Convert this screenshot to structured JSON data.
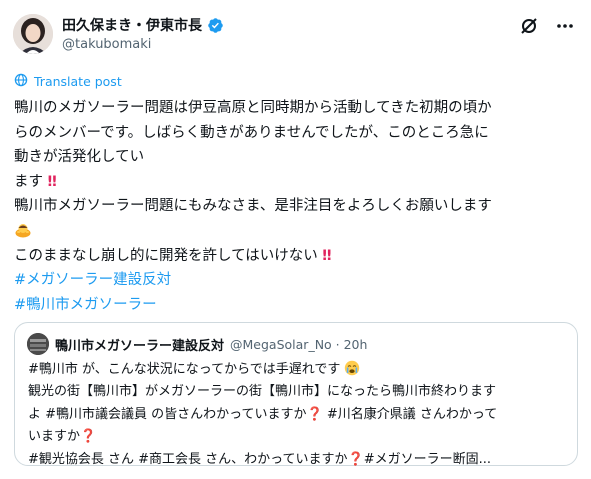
{
  "author": {
    "name": "田久保まき・伊東市長",
    "handle": "@takubomaki"
  },
  "translate": {
    "label": "Translate post"
  },
  "post": {
    "l1": "鴨川のメガソーラー問題は伊豆高原と同時期から活動してきた初期の頃か",
    "l2": "らのメンバーです。しばらく動きがありませんでしたが、このところ急に",
    "l3": "動きが活発化してい",
    "l4": "ます",
    "l5": "鴨川市メガソーラー問題にもみなさま、是非注目をよろしくお願いします",
    "l7": "このままなし崩し的に開発を許してはいけない",
    "tag1": "#メガソーラー建設反対",
    "tag2": "#鴨川市メガソーラー",
    "bang": "‼"
  },
  "quote": {
    "name": "鴨川市メガソーラー建設反対",
    "meta": "@MegaSolar_No · 20h",
    "l1": "#鴨川市 が、こんな状況になってからでは手遅れです",
    "l2": "観光の街【鴨川市】がメガソーラーの街【鴨川市】になったら鴨川市終わります",
    "l3a": "よ #鴨川市議会議員 の皆さんわかっていますか",
    "l3b": " #川名康介県議 さんわかって",
    "l4": "いますか",
    "l5a": " #観光協会長 さん #商工会長 さん、わかっていますか",
    "l5b": "#メガソーラー断固...",
    "qmark": "❓"
  },
  "icons": {
    "verified": "verified-badge",
    "grok": "grok-icon",
    "more": "more-icon",
    "translate": "translate-icon",
    "emoji_bow": "bowing-person-emoji",
    "emoji_cry": "crying-face-emoji"
  },
  "colors": {
    "accent": "#1d9bf0",
    "text": "#0f1419",
    "secondary": "#536471",
    "alert": "#e0245e"
  }
}
